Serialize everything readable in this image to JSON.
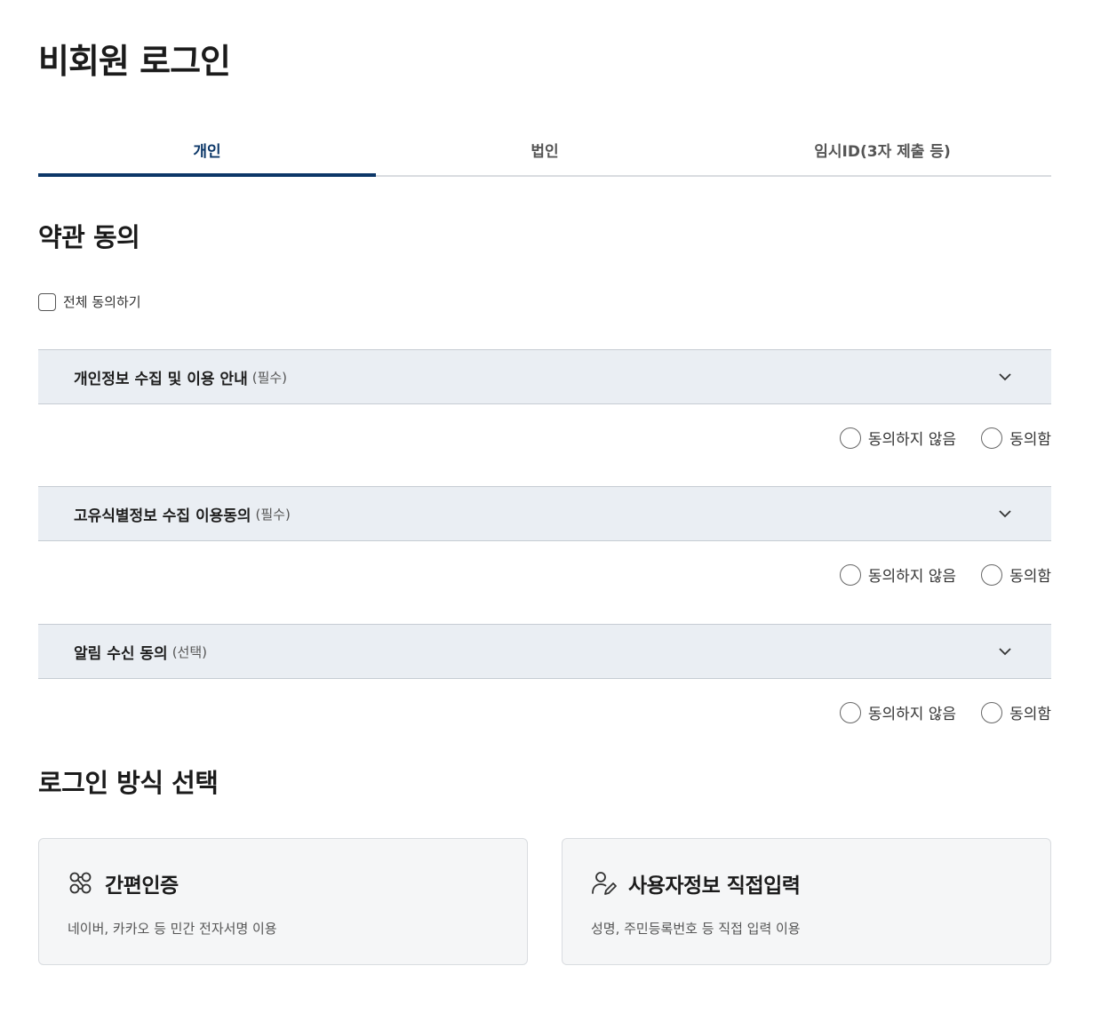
{
  "page": {
    "title": "비회원 로그인"
  },
  "tabs": [
    {
      "label": "개인",
      "active": true
    },
    {
      "label": "법인",
      "active": false
    },
    {
      "label": "임시ID(3자 제출 등)",
      "active": false
    }
  ],
  "terms": {
    "title": "약관 동의",
    "agree_all_label": "전체 동의하기",
    "items": [
      {
        "title": "개인정보 수집 및 이용 안내",
        "tag": "(필수)",
        "disagree_label": "동의하지 않음",
        "agree_label": "동의함"
      },
      {
        "title": "고유식별정보 수집 이용동의",
        "tag": "(필수)",
        "disagree_label": "동의하지 않음",
        "agree_label": "동의함"
      },
      {
        "title": "알림 수신 동의",
        "tag": "(선택)",
        "disagree_label": "동의하지 않음",
        "agree_label": "동의함"
      }
    ]
  },
  "login_method": {
    "title": "로그인 방식 선택",
    "cards": [
      {
        "icon": "simple-auth-icon",
        "title": "간편인증",
        "desc": "네이버, 카카오 등 민간 전자서명 이용"
      },
      {
        "icon": "user-edit-icon",
        "title": "사용자정보 직접입력",
        "desc": "성명, 주민등록번호 등 직접 입력 이용"
      }
    ]
  },
  "colors": {
    "accent": "#0c3768",
    "accordion_bg": "#eaeef3",
    "card_bg": "#f5f6f7"
  }
}
